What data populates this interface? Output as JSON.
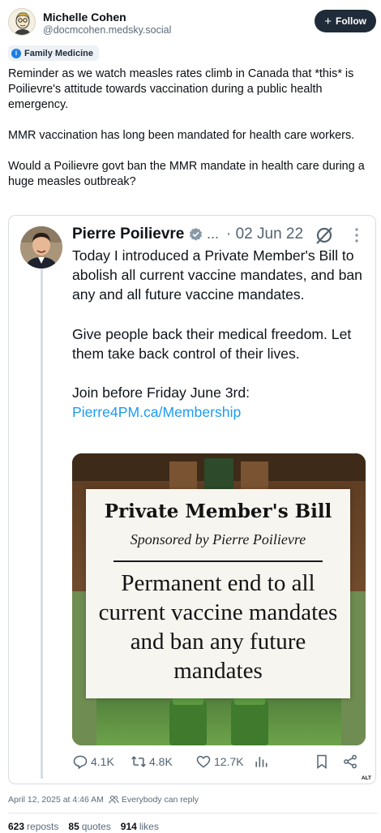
{
  "author": {
    "name": "Michelle Cohen",
    "handle": "@docmcohen.medsky.social",
    "follow_label": "Follow"
  },
  "label": {
    "text": "Family Medicine"
  },
  "post": {
    "paragraphs": [
      "Reminder as we watch measles rates climb in Canada that *this* is Poilievre's attitude towards vaccination during a public health emergency.",
      "MMR vaccination has long been mandated for health care workers.",
      "Would a Poilievre govt ban the MMR mandate in health care during a huge measles outbreak?"
    ]
  },
  "quoted": {
    "name": "Pierre Poilievre",
    "dots": "...",
    "date": "· 02 Jun 22",
    "paragraphs": [
      "Today I introduced a Private Member's Bill to abolish all current vaccine mandates, and ban any and all future vaccine mandates.",
      "Give people back their medical freedom. Let them take back control of their lives."
    ],
    "join_text": "Join before Friday June 3rd:",
    "link": "Pierre4PM.ca/Membership",
    "image": {
      "title": "Private Member's Bill",
      "subtitle": "Sponsored by Pierre Poilievre",
      "body": "Permanent end to all current vaccine mandates and ban any future mandates"
    },
    "actions": {
      "replies": "4.1K",
      "reposts": "4.8K",
      "likes": "12.7K"
    }
  },
  "alt_badge": "ALT",
  "meta": {
    "timestamp": "April 12, 2025 at 4:46 AM",
    "reply_setting": "Everybody can reply"
  },
  "stats": {
    "reposts_count": "623",
    "reposts_label": "reposts",
    "quotes_count": "85",
    "quotes_label": "quotes",
    "likes_count": "914",
    "likes_label": "likes"
  },
  "colors": {
    "link": "#1d9bf0",
    "follow_bg": "#1f2b38",
    "chip_icon": "#1a7fe6"
  }
}
